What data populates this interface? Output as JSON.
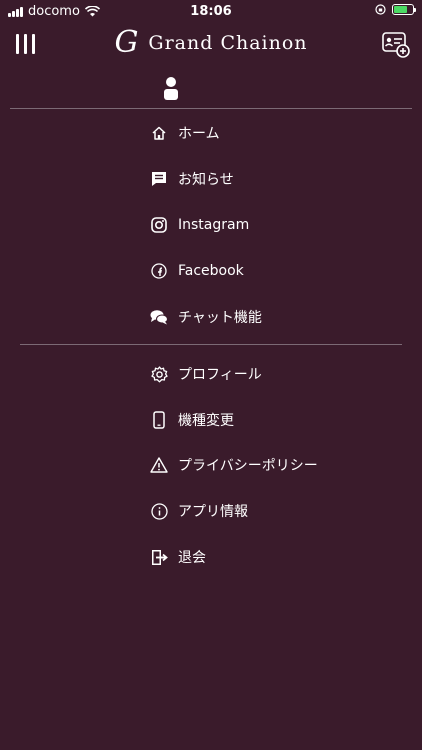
{
  "status": {
    "carrier": "docomo",
    "time": "18:06"
  },
  "brand": {
    "mark": "G",
    "name": "Grand Chainon"
  },
  "menu": {
    "primary": [
      {
        "label": "ホーム",
        "icon": "home-icon"
      },
      {
        "label": "お知らせ",
        "icon": "message-icon"
      },
      {
        "label": "Instagram",
        "icon": "instagram-icon"
      },
      {
        "label": "Facebook",
        "icon": "facebook-icon"
      },
      {
        "label": "チャット機能",
        "icon": "chat-icon"
      }
    ],
    "secondary": [
      {
        "label": "プロフィール",
        "icon": "gear-icon"
      },
      {
        "label": "機種変更",
        "icon": "phone-icon"
      },
      {
        "label": "プライバシーポリシー",
        "icon": "warning-icon"
      },
      {
        "label": "アプリ情報",
        "icon": "info-icon"
      },
      {
        "label": "退会",
        "icon": "logout-icon"
      }
    ]
  },
  "colors": {
    "background": "#3a1b2b",
    "divider": "#7c6a75",
    "battery": "#4cd964"
  }
}
